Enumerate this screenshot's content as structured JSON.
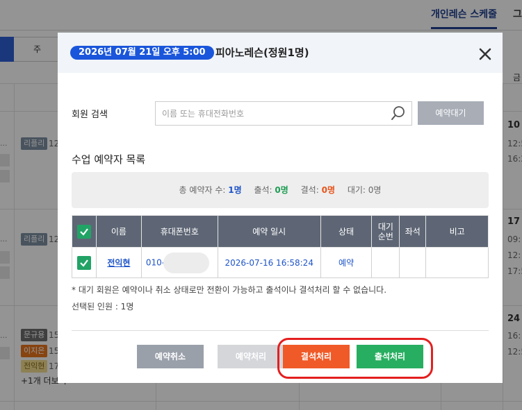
{
  "background": {
    "active_tab": "개인레슨 스케줄",
    "other_tab": "그",
    "view_toggle": "주",
    "day_header_partial": "금",
    "dates": [
      "10",
      "17",
      "24"
    ],
    "times": [
      "12:5",
      "16:2",
      "09:",
      "12:",
      "17:5",
      "16:",
      "12:5"
    ],
    "instructor_chips": [
      "리플리",
      "리플리",
      "문규용",
      "이지은",
      "전익현"
    ],
    "chip_suffixes": [
      "12",
      "12",
      "15",
      "15",
      "17"
    ],
    "more_link": "+1개 더보기"
  },
  "modal": {
    "date_label": "2026년 07월 21일 오후 5:00",
    "class_title": "피아노레슨(정원1명)",
    "close_icon": "close-icon",
    "search": {
      "label": "회원 검색",
      "placeholder": "이름 또는 휴대전화번호",
      "value": "",
      "icon": "search-icon",
      "waitlist_button": "예약대기"
    },
    "list_title": "수업 예약자 목록",
    "summary": {
      "total_label": "총 예약자 수:",
      "total_value": "1명",
      "attend_label": "출석:",
      "attend_value": "0명",
      "absent_label": "결석:",
      "absent_value": "0명",
      "wait_label": "대기:",
      "wait_value": "0명"
    },
    "table": {
      "headers": [
        "이름",
        "휴대폰번호",
        "예약 일시",
        "상태",
        "대기\n순번",
        "좌석",
        "비고"
      ],
      "rows": [
        {
          "checked": true,
          "name": "전익현",
          "phone": "010-",
          "reserved_at": "2026-07-16 16:58:24",
          "status": "예약",
          "wait_no": "",
          "seat": "",
          "note": ""
        }
      ]
    },
    "notice": "* 대기 회원은 예약이나 취소 상태로만 전환이 가능하고 출석이나 결석처리 할 수 없습니다.",
    "selected_count": "선택된 인원 : 1명",
    "buttons": {
      "cancel": "예약취소",
      "reserve": "예약처리",
      "absent": "결석처리",
      "attend": "출석처리"
    }
  },
  "colors": {
    "accent_blue": "#1a56db",
    "table_header": "#5e6675",
    "absent_button": "#f05a28",
    "attend_button": "#27ae60",
    "highlight_ring": "#e41f1f"
  }
}
